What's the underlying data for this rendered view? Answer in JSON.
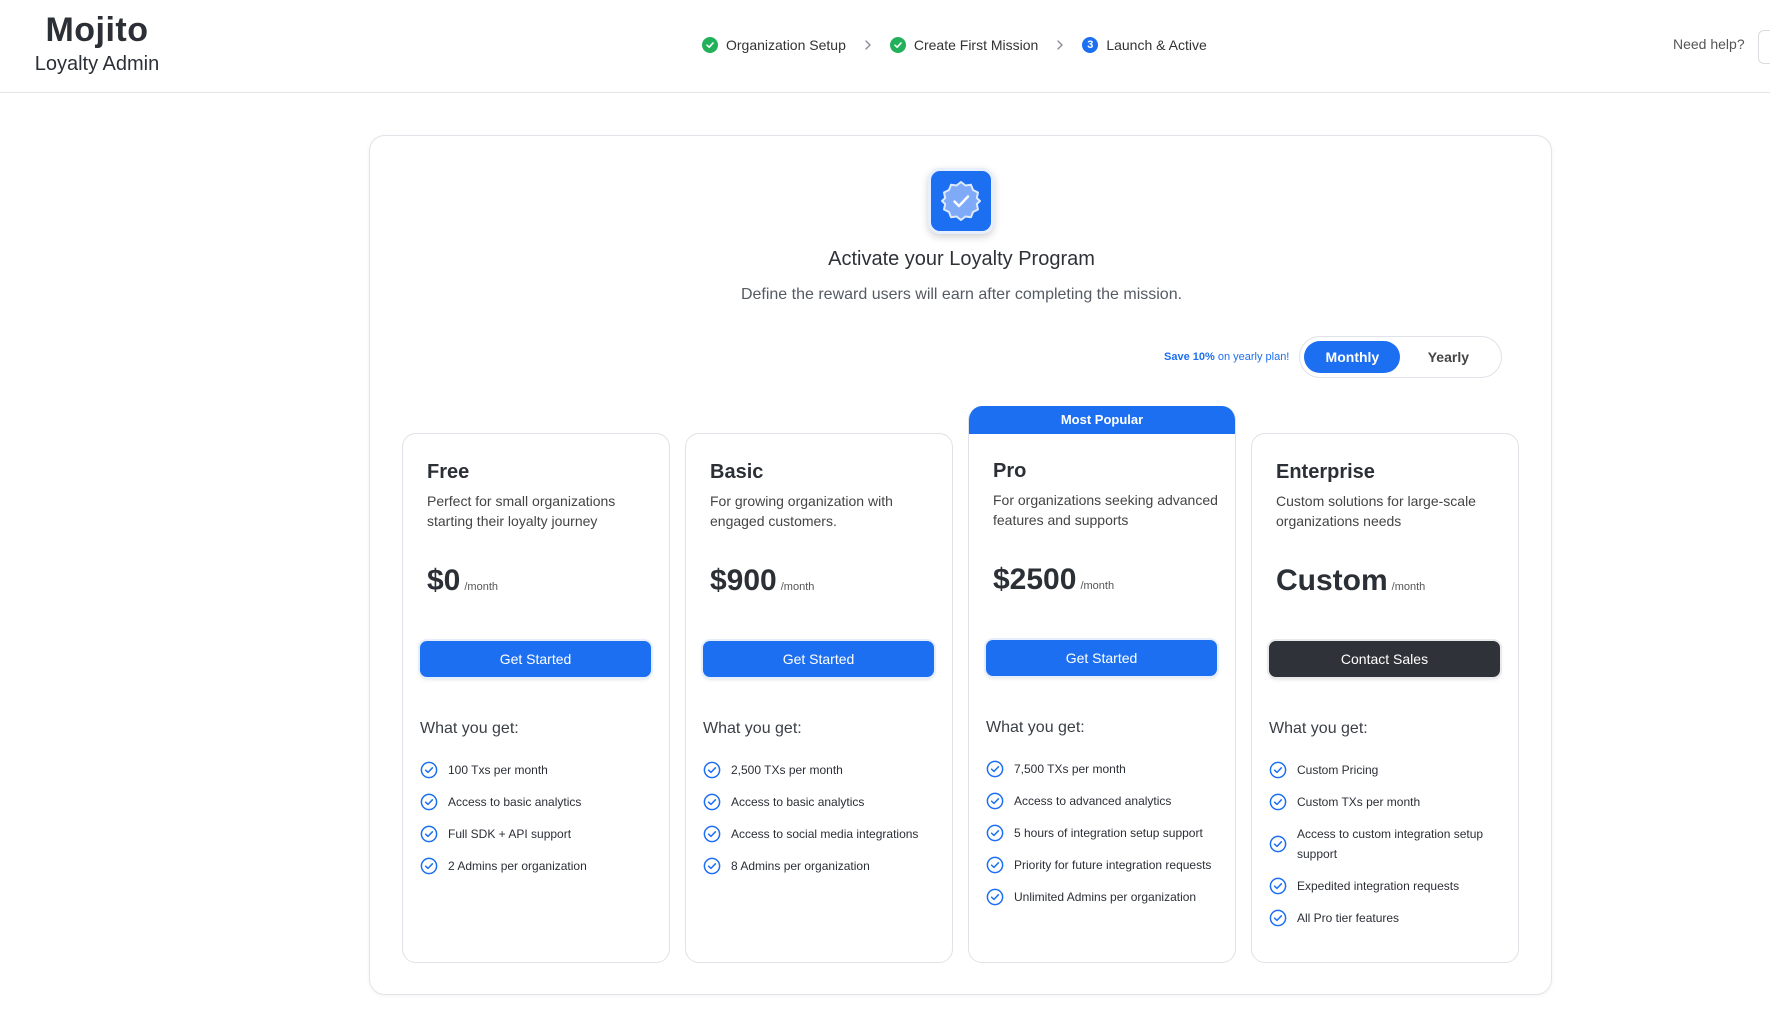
{
  "header": {
    "brand": "Mojito",
    "subtitle": "Loyalty Admin",
    "steps": [
      {
        "label": "Organization Setup",
        "state": "done"
      },
      {
        "label": "Create First Mission",
        "state": "done"
      },
      {
        "label": "Launch & Active",
        "state": "current",
        "number": "3"
      }
    ],
    "help_label": "Need help?"
  },
  "main": {
    "title": "Activate your Loyalty Program",
    "subtitle": "Define the reward users will earn after completing the mission.",
    "billing": {
      "save_bold": "Save 10%",
      "save_rest": " on yearly plan!",
      "monthly": "Monthly",
      "yearly": "Yearly",
      "selected": "Monthly"
    },
    "features_heading": "What you get:",
    "plans": [
      {
        "name": "Free",
        "description": "Perfect for small organizations starting their loyalty journey",
        "price": "$0",
        "unit": "/month",
        "button": "Get Started",
        "features": [
          "100 Txs per month",
          "Access to basic analytics",
          "Full SDK + API support",
          "2 Admins per organization"
        ]
      },
      {
        "name": "Basic",
        "description": "For growing organization with engaged customers.",
        "price": "$900",
        "unit": "/month",
        "button": "Get Started",
        "features": [
          "2,500 TXs per month",
          "Access to basic analytics",
          "Access to social media integrations",
          "8 Admins per organization"
        ]
      },
      {
        "name": "Pro",
        "badge": "Most Popular",
        "description": "For organizations seeking advanced features and supports",
        "price": "$2500",
        "unit": "/month",
        "button": "Get Started",
        "features": [
          "7,500 TXs per month",
          "Access to advanced analytics",
          "5 hours of integration setup support",
          "Priority for future integration requests",
          "Unlimited Admins per organization"
        ]
      },
      {
        "name": "Enterprise",
        "description": "Custom solutions for large-scale organizations needs",
        "price": "Custom",
        "unit": "/month",
        "button": "Contact Sales",
        "features": [
          "Custom Pricing",
          "Custom TXs per month",
          "Access to custom integration setup support",
          "Expedited integration requests",
          "All Pro tier features"
        ]
      }
    ]
  },
  "colors": {
    "primary": "#1d6ff2",
    "success": "#22b15a",
    "dark_button": "#2f3339"
  }
}
